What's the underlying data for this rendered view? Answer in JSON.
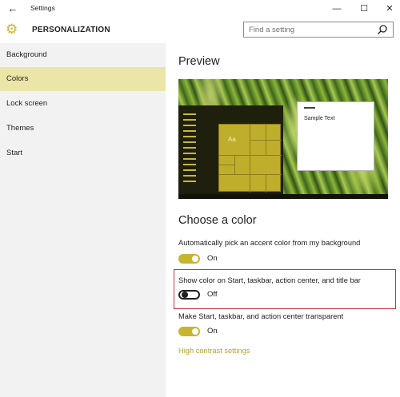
{
  "window": {
    "title": "Settings",
    "back_glyph": "←",
    "minimize_glyph": "—",
    "maximize_glyph": "☐",
    "close_glyph": "✕"
  },
  "header": {
    "title": "PERSONALIZATION",
    "gear_glyph": "⚙",
    "search_placeholder": "Find a setting"
  },
  "sidebar": {
    "items": [
      {
        "label": "Background",
        "selected": false
      },
      {
        "label": "Colors",
        "selected": true
      },
      {
        "label": "Lock screen",
        "selected": false
      },
      {
        "label": "Themes",
        "selected": false
      },
      {
        "label": "Start",
        "selected": false
      }
    ]
  },
  "main": {
    "preview_heading": "Preview",
    "preview_tile_text": "Aa",
    "preview_sample_text": "Sample Text",
    "choose_heading": "Choose a color",
    "settings": [
      {
        "label": "Automatically pick an accent color from my background",
        "state": "On"
      },
      {
        "label": "Show color on Start, taskbar, action center, and title bar",
        "state": "Off"
      },
      {
        "label": "Make Start, taskbar, and action center transparent",
        "state": "On"
      }
    ],
    "link": "High contrast settings"
  },
  "colors": {
    "accent": "#c7b52f",
    "selected_nav": "#ebe5a7",
    "sidebar_bg": "#f2f2f2",
    "highlight_border": "#c8323a"
  },
  "icons": {
    "back": "back-arrow-icon",
    "gear": "gear-icon",
    "search": "search-icon"
  }
}
